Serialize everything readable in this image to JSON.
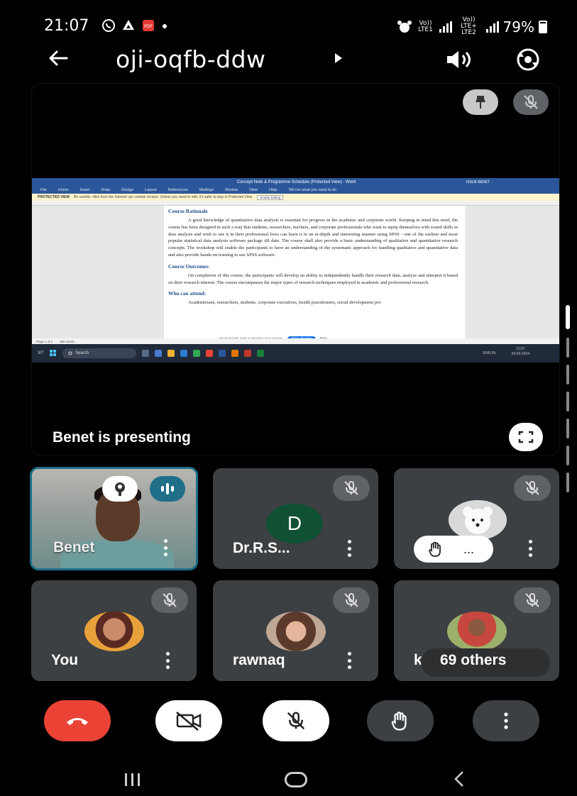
{
  "status_bar": {
    "time": "21:07",
    "net1": "Vo)) LTE1",
    "net2": "Vo)) LTE+ LTE2",
    "battery": "79%"
  },
  "header": {
    "meeting_code": "oji-oqfb-ddw"
  },
  "presentation": {
    "label": "Benet is presenting",
    "shared_screen": {
      "window_title": "Concept Note & Programme Schedule (Protected View) - Word",
      "user": "ISSUE BENET",
      "ribbon_tabs": [
        "File",
        "Home",
        "Insert",
        "Draw",
        "Design",
        "Layout",
        "References",
        "Mailings",
        "Review",
        "View",
        "Help",
        "Tell me what you want to do"
      ],
      "protected_title": "PROTECTED VIEW",
      "protected_msg": "Be careful—files from the Internet can contain viruses. Unless you need to edit, it's safer to stay in Protected View.",
      "enable_editing": "Enable Editing",
      "heading1": "Course Rationale",
      "para1": "A good knowledge of quantitative data analysis is essential for progress in the academic and corporate world. Keeping in mind this need, the course has been designed in such a way that students, researchers, teachers, and corporate professionals who want to equip themselves with sound skills in data analysis and wish to use it in their professional lives can learn it in an in-depth and interesting manner using SPSS - one of the earliest and most popular statistical data analysis software package till date. The course shall also provide a basic understanding of qualitative and quantitative research concepts. The workshop will enable the participants to have an understanding of the systematic approach for handling qualitative and quantitative data and also provide hands-on training to use SPSS software.",
      "heading2": "Course Outcomes",
      "para2": "On completion of this course, the participants will develop an ability to independently handle their research data, analyze and interpret it based on their research interest. The course encompasses the major types of research techniques employed in academic and professional research.",
      "heading3": "Who can attend:",
      "para3": "Academicians, researchers, students, corporate executives, health practitioners, social development pro",
      "share_notice": "meet.google.com is sharing your screen.",
      "stop_sharing": "Stop sharing",
      "hide": "Hide",
      "word_status": [
        "Page 1 of 2",
        "356 words"
      ],
      "taskbar_search": "Search",
      "taskbar_weather": "30°",
      "taskbar_lang": "ENG IN",
      "taskbar_clock": "21:07",
      "taskbar_date": "29-03-2024"
    }
  },
  "participants": [
    {
      "name": "Benet",
      "speaking": true,
      "lowered_hand": true
    },
    {
      "name": "Dr.R.S...",
      "avatar_letter": "D",
      "muted": true
    },
    {
      "name": "",
      "muted": true,
      "hand_raised": true,
      "hand_label": "..."
    },
    {
      "name": "You",
      "muted": true
    },
    {
      "name": "rawnaq",
      "muted": true
    },
    {
      "name": "ku",
      "muted": true,
      "others_label": "69 others"
    }
  ],
  "colors": {
    "end_call": "#ea4335",
    "tile_bg": "#3c4043",
    "speaking_accent": "#1f6f88",
    "avatar_d": "#0f5132"
  },
  "icons": {
    "back": "arrow-left-icon",
    "speaker": "speaker-icon",
    "switch_camera": "switch-camera-icon",
    "pin": "pin-icon",
    "mic_off": "mic-off-icon",
    "fullscreen": "fullscreen-icon",
    "end_call": "phone-hangup-icon",
    "camera_off": "camera-off-icon",
    "hand": "hand-icon",
    "more": "more-vert-icon"
  }
}
